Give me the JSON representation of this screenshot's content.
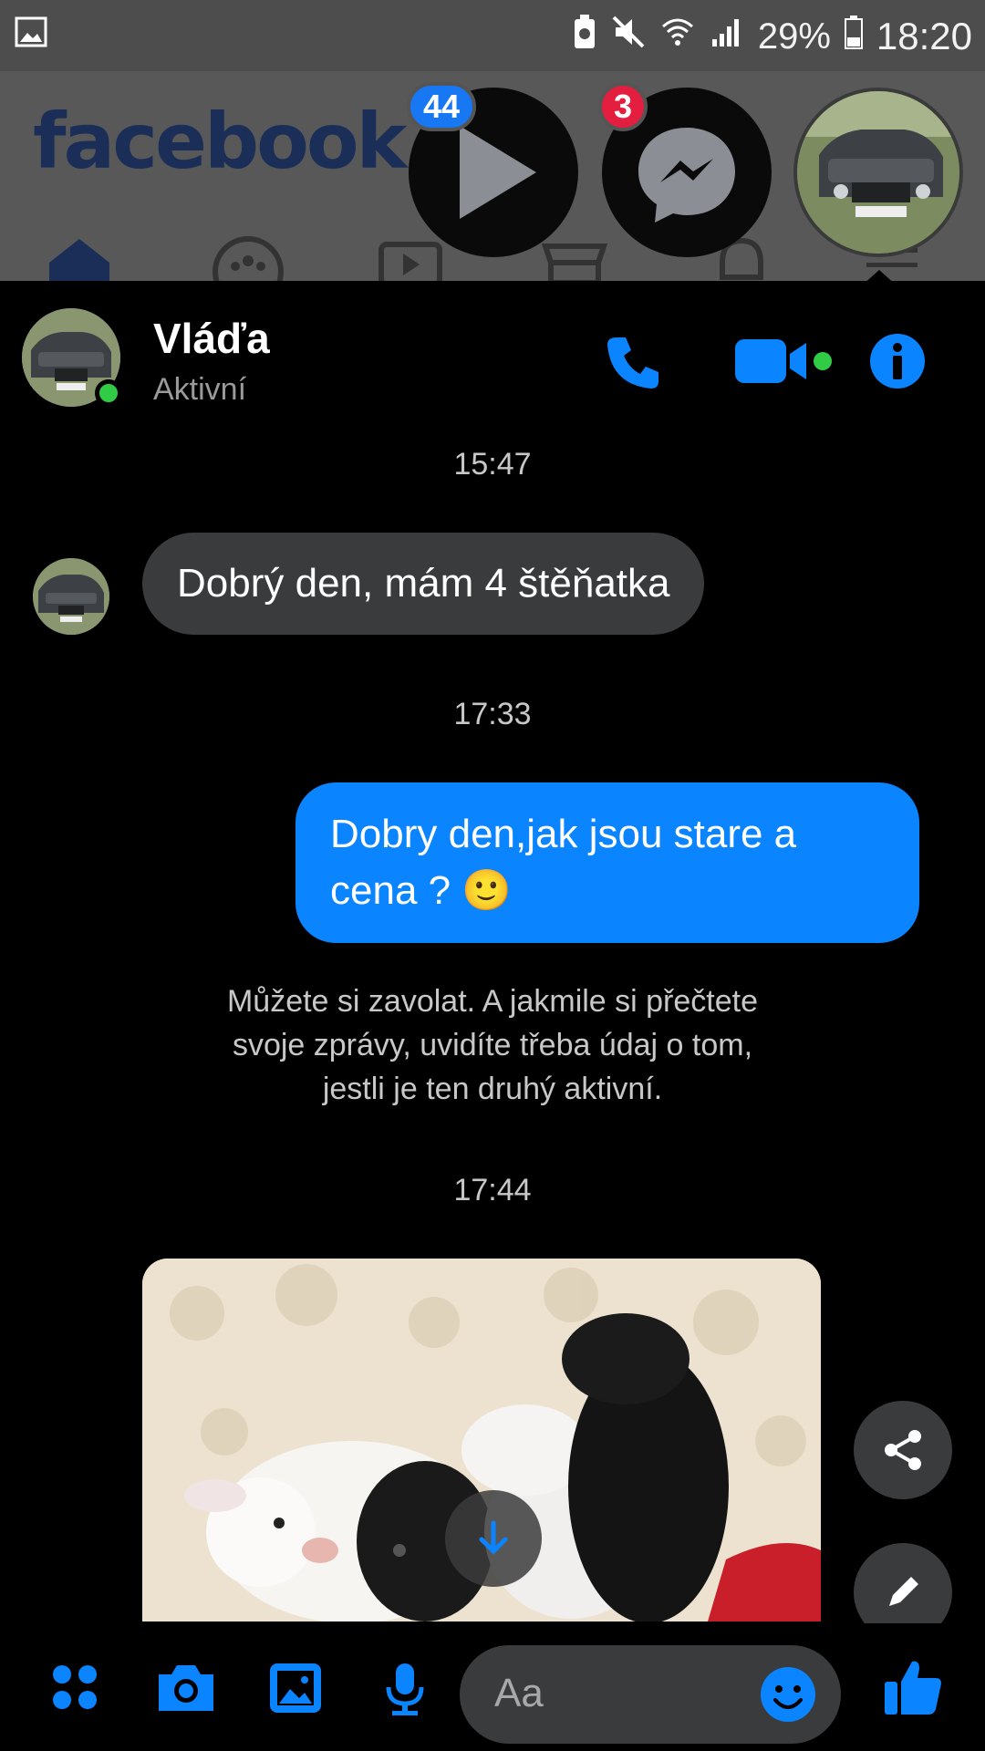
{
  "status_bar": {
    "battery": "29%",
    "time": "18:20"
  },
  "facebook": {
    "logo": "facebook"
  },
  "chat_heads": {
    "video_badge": "44",
    "messenger_badge": "3"
  },
  "header": {
    "name": "Vláďa",
    "status": "Aktivní"
  },
  "messages": {
    "time1": "15:47",
    "incoming1": "Dobrý den, mám 4 štěňatka",
    "time2": "17:33",
    "outgoing1_line1": "Dobry den,jak jsou stare a",
    "outgoing1_line2": "cena ? ",
    "outgoing1_emoji": "🙂",
    "notice_line1": "Můžete si zavolat. A jakmile si přečtete",
    "notice_line2": "svoje zprávy, uvidíte třeba údaj o tom,",
    "notice_line3": "jestli je ten druhý aktivní.",
    "time3": "17:44"
  },
  "composer": {
    "placeholder": "Aa"
  },
  "colors": {
    "accent": "#0a84ff",
    "online": "#31cc46",
    "badge_red": "#e41e3f",
    "badge_blue": "#1877f2"
  }
}
